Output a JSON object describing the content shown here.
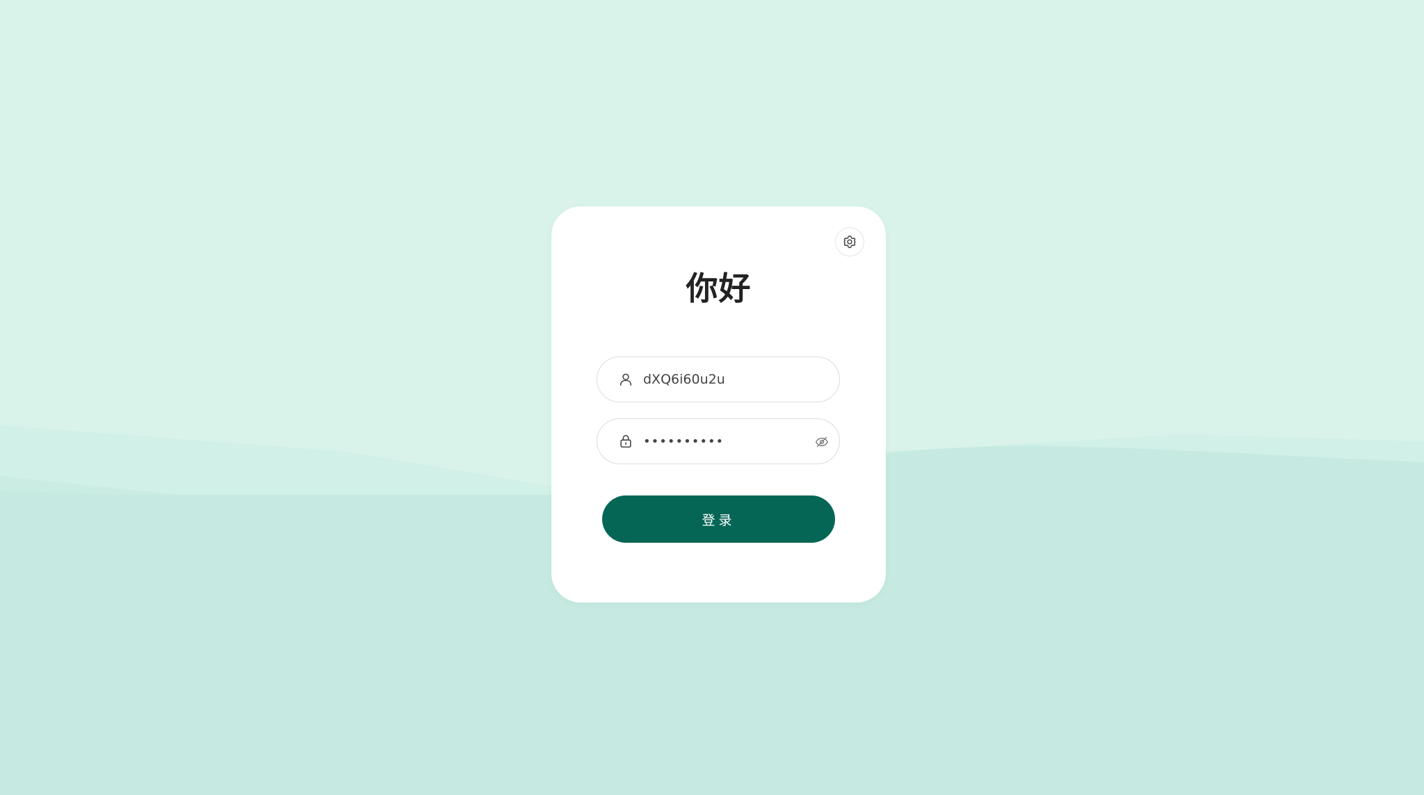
{
  "colors": {
    "background": "#d9f3eb",
    "wave_light": "#d1f0e7",
    "wave_mid": "#cbece3",
    "wave_dark": "#c6eae1",
    "card": "#ffffff",
    "primary": "#056656",
    "title_text": "#222222"
  },
  "header": {
    "settings_icon": "gear-icon"
  },
  "login": {
    "title": "你好",
    "username": {
      "icon": "user-icon",
      "value": "dXQ6i60u2u"
    },
    "password": {
      "icon": "lock-icon",
      "value": "••••••••••",
      "toggle_icon": "eye-off-icon"
    },
    "submit_label": "登录"
  }
}
